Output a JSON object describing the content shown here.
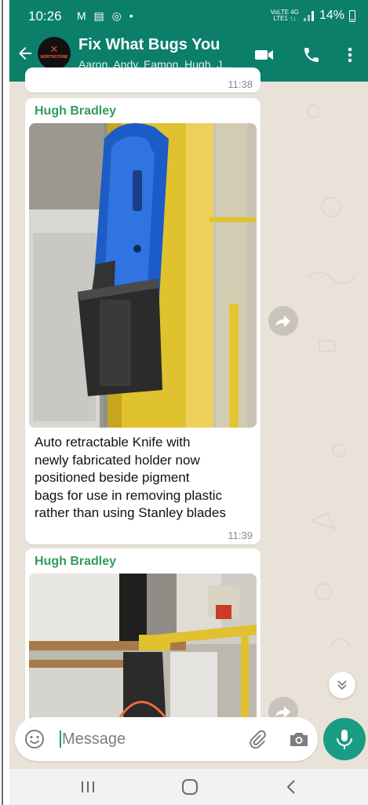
{
  "status": {
    "time": "10:26",
    "notifications": "M ▤ ◎ •",
    "net_top": "VoLTE 4G",
    "net_bottom": "LTE1 ↑↓",
    "battery": "14%"
  },
  "header": {
    "title": "Fix What Bugs You",
    "subtitle": "Aaron, Andy, Eamon, Hugh, J...",
    "avatar_text": "NORTHSTONE"
  },
  "chat": {
    "prev_timestamp": "11:38",
    "messages": [
      {
        "sender": "Hugh Bradley",
        "caption": [
          "Auto retractable Knife with",
          "newly fabricated holder now",
          "positioned beside pigment",
          "bags for use in removing plastic",
          "rather than using Stanley blades"
        ],
        "time": "11:39"
      },
      {
        "sender": "Hugh Bradley"
      }
    ]
  },
  "composer": {
    "placeholder": "Message"
  },
  "colors": {
    "brand": "#0b7f6a",
    "accent": "#1a9b84",
    "sender": "#2f9d5f",
    "wallpaper": "#e9e2d9"
  },
  "icons": [
    "back-arrow-icon",
    "video-call-icon",
    "phone-icon",
    "more-vert-icon",
    "forward-icon",
    "double-chevron-down-icon",
    "emoji-icon",
    "attach-icon",
    "camera-icon",
    "mic-icon",
    "nav-recents-icon",
    "nav-home-icon",
    "nav-back-icon"
  ]
}
